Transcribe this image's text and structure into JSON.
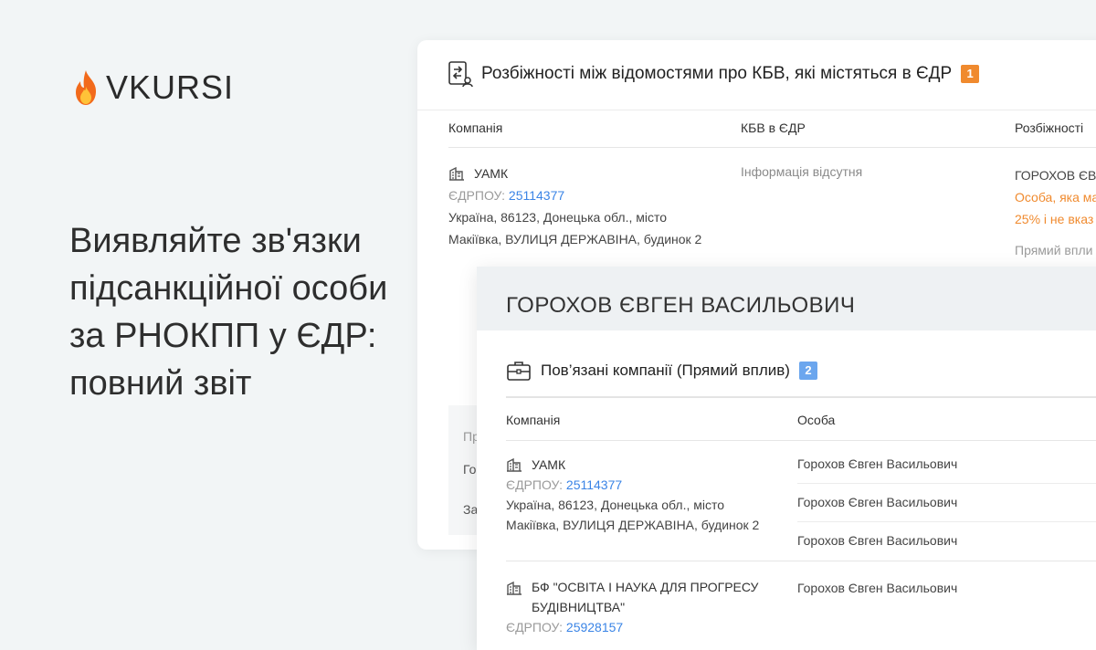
{
  "brand": {
    "name": "VKURSI",
    "icon": "flame-icon",
    "colors": {
      "flame_outer": "#f26a1b",
      "flame_inner": "#ffc238"
    }
  },
  "headline": "Виявляйте зв'язки підсанкційної особи за РНОКПП у ЄДР: повний звіт",
  "back_card": {
    "title": "Розбіжності між відомостями про КБВ, які містяться в ЄДР",
    "badge": "1",
    "columns": {
      "company": "Компанія",
      "kbv": "КБВ в ЄДР",
      "disc": "Розбіжності"
    },
    "row": {
      "company": "УАМК",
      "edrpou_label": "ЄДРПОУ:",
      "edrpou": "25114377",
      "address": "Україна, 86123, Донецька обл., місто Макіївка, ВУЛИЦЯ ДЕРЖАВІНА, будинок 2",
      "kbv": "Інформація відсутня",
      "disc_name": "ГОРОХОВ ЄВ",
      "disc_line1": "Особа, яка ма",
      "disc_line2": "25% і не вказ",
      "disc_extra": "Прямий впли"
    },
    "footer": {
      "line1": "Пр",
      "line2": "Го",
      "line3": "За"
    }
  },
  "front_card": {
    "person": "ГОРОХОВ ЄВГЕН ВАСИЛЬОВИЧ",
    "section_title": "Пов’язані компанії (Прямий вплив)",
    "badge": "2",
    "columns": {
      "company": "Компанія",
      "person": "Особа"
    },
    "companies": [
      {
        "name": "УАМК",
        "edrpou_label": "ЄДРПОУ:",
        "edrpou": "25114377",
        "address": "Україна, 86123, Донецька обл., місто Макіївка, ВУЛИЦЯ ДЕРЖАВІНА, будинок 2",
        "persons": [
          "Горохов Євген Васильович",
          "Горохов Євген Васильович",
          "Горохов Євген Васильович"
        ]
      },
      {
        "name": "БФ \"ОСВІТА І НАУКА ДЛЯ ПРОГРЕСУ БУДІВНИЦТВА\"",
        "edrpou_label": "ЄДРПОУ:",
        "edrpou": "25928157",
        "persons": [
          "Горохов Євген Васильович"
        ]
      }
    ]
  }
}
